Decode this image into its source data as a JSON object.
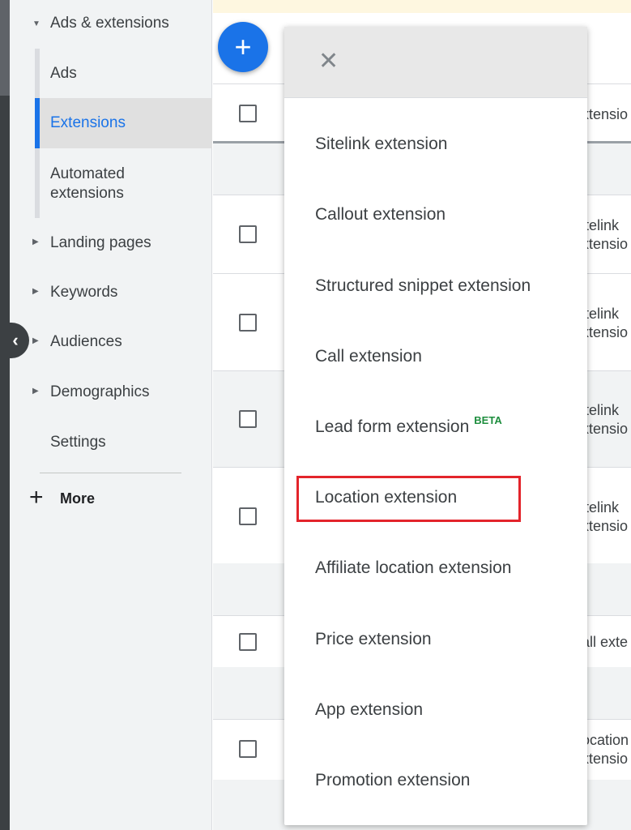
{
  "sidebar": {
    "section": "Ads & extensions",
    "sub_items": [
      "Ads",
      "Extensions",
      "Automated extensions"
    ],
    "items": [
      "Landing pages",
      "Keywords",
      "Audiences",
      "Demographics"
    ],
    "settings": "Settings",
    "more": "More"
  },
  "table": {
    "cells": [
      "xtensio",
      "itelink",
      "xtensio",
      "itelink",
      "xtensio",
      "itelink",
      "xtensio",
      "itelink",
      "xtensio",
      "all exte",
      "ocation",
      "xtensio"
    ]
  },
  "menu": {
    "items": [
      "Sitelink extension",
      "Callout extension",
      "Structured snippet extension",
      "Call extension",
      "Lead form extension",
      "Location extension",
      "Affiliate location extension",
      "Price extension",
      "App extension",
      "Promotion extension"
    ],
    "beta_badge": "BETA",
    "highlighted_item": "Location extension"
  },
  "colors": {
    "accent": "#1a73e8",
    "highlight": "#e3242b",
    "beta": "#1e8e3e"
  },
  "icons": {
    "fab": "add-icon",
    "close": "close-icon",
    "collapse": "chevron-left-icon"
  }
}
